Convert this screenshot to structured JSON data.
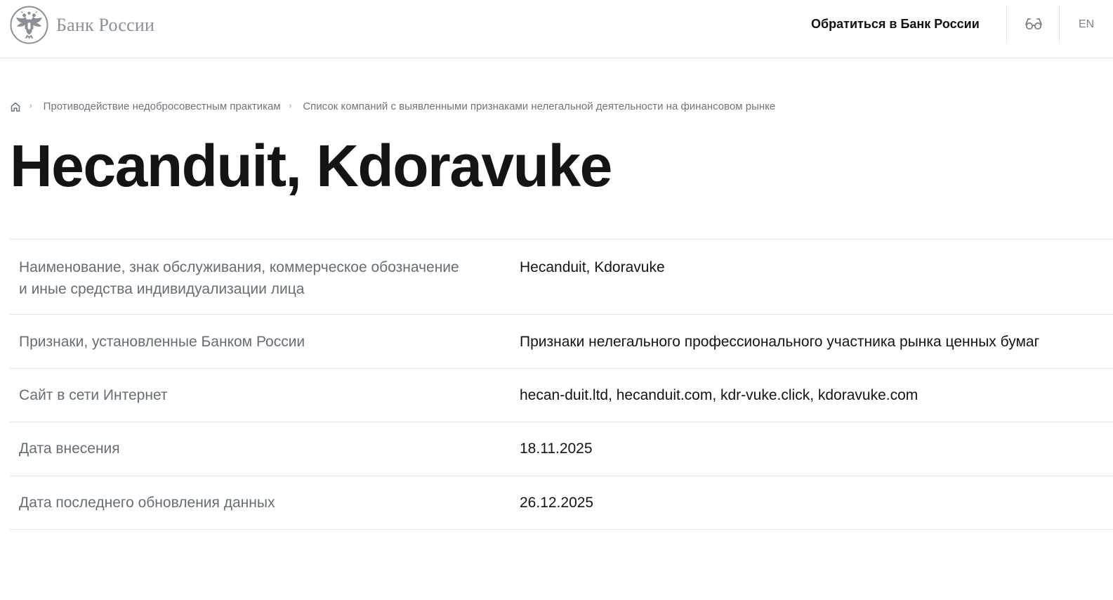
{
  "header": {
    "logo_text": "Банк России",
    "contact_link": "Обратиться в Банк России",
    "lang_link": "EN",
    "icons": {
      "logo": "bank-emblem-icon",
      "accessibility": "glasses-icon"
    }
  },
  "breadcrumb": {
    "home_icon": "home-icon",
    "items": [
      "Противодействие недобросовестным практикам",
      "Список компаний с выявленными признаками нелегальной деятельности на финансовом рынке"
    ]
  },
  "page": {
    "title": "Hecanduit, Kdoravuke"
  },
  "info": {
    "rows": [
      {
        "label": "Наименование, знак обслуживания, коммерческое обозначение и иные средства индивидуализации лица",
        "value": "Hecanduit, Kdoravuke"
      },
      {
        "label": "Признаки, установленные Банком России",
        "value": "Признаки нелегального профессионального участника рынка ценных бумаг"
      },
      {
        "label": "Сайт в сети Интернет",
        "value": "hecan-duit.ltd, hecanduit.com, kdr-vuke.click, kdoravuke.com"
      },
      {
        "label": "Дата внесения",
        "value": "18.11.2025"
      },
      {
        "label": "Дата последнего обновления данных",
        "value": "26.12.2025"
      }
    ]
  },
  "colors": {
    "text_primary": "#141414",
    "text_secondary": "#676d74",
    "logo_gray": "#8b9096",
    "divider": "#e3e5e8"
  }
}
